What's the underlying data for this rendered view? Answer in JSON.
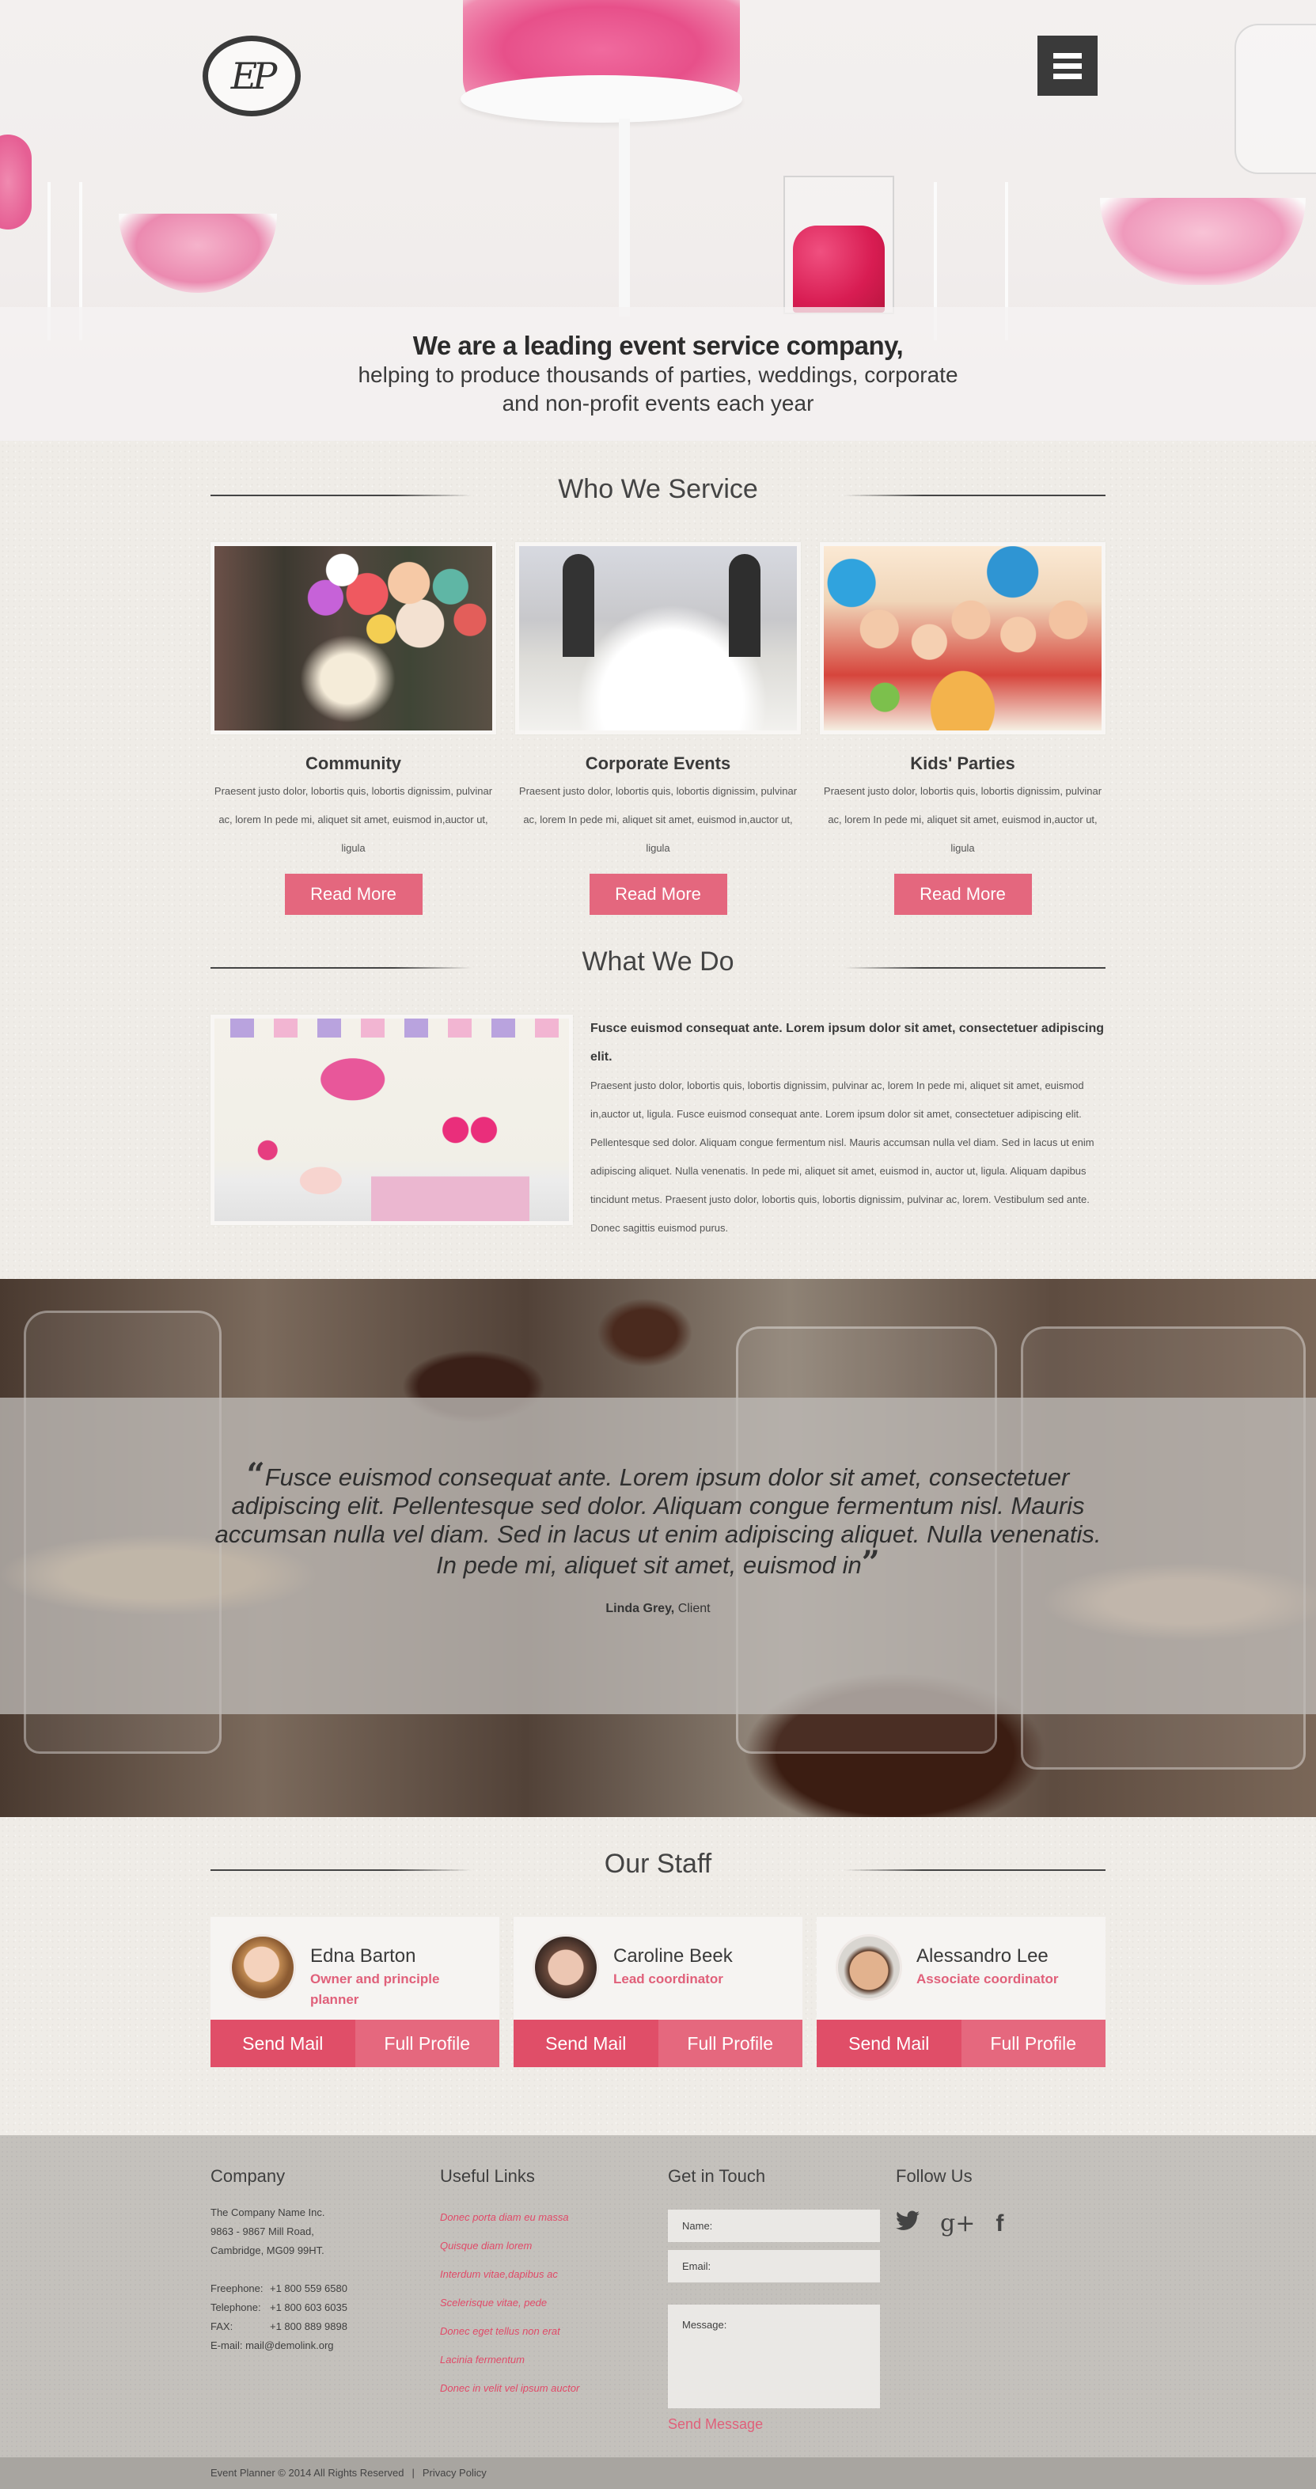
{
  "header": {
    "logo_text": "EP",
    "menu_icon": "hamburger-icon"
  },
  "hero": {
    "headline": "We are a leading event service company,",
    "subline_1": "helping to produce thousands of parties, weddings, corporate",
    "subline_2": "and non-profit events each year"
  },
  "who_we_service": {
    "title": "Who We Service",
    "items": [
      {
        "title": "Community",
        "text": "Praesent justo dolor, lobortis quis, lobortis dignissim, pulvinar ac, lorem In pede mi, aliquet sit amet, euismod in,auctor ut, ligula",
        "button": "Read More"
      },
      {
        "title": "Corporate Events",
        "text": "Praesent justo dolor, lobortis quis, lobortis dignissim, pulvinar ac, lorem In pede mi, aliquet sit amet, euismod in,auctor ut, ligula",
        "button": "Read More"
      },
      {
        "title": "Kids' Parties",
        "text": "Praesent justo dolor, lobortis quis, lobortis dignissim, pulvinar ac, lorem In pede mi, aliquet sit amet, euismod in,auctor ut, ligula",
        "button": "Read More"
      }
    ]
  },
  "what_we_do": {
    "title": "What We Do",
    "heading": "Fusce euismod consequat ante. Lorem ipsum dolor sit amet, consectetuer adipiscing elit.",
    "body": "Praesent justo dolor, lobortis quis, lobortis dignissim, pulvinar ac, lorem In pede mi, aliquet sit amet, euismod in,auctor ut, ligula. Fusce euismod consequat ante. Lorem ipsum dolor sit amet, consectetuer adipiscing elit. Pellentesque sed dolor. Aliquam congue fermentum nisl. Mauris accumsan nulla vel diam. Sed in lacus ut enim adipiscing aliquet. Nulla venenatis. In pede mi, aliquet sit amet, euismod in, auctor ut, ligula. Aliquam dapibus tincidunt metus. Praesent justo dolor, lobortis quis, lobortis dignissim, pulvinar ac, lorem. Vestibulum sed ante. Donec sagittis euismod purus."
  },
  "testimonial": {
    "open_quote": "“",
    "close_quote": "”",
    "quote": "Fusce euismod consequat ante. Lorem ipsum dolor sit amet, consectetuer adipiscing elit. Pellentesque sed dolor. Aliquam congue fermentum nisl. Mauris accumsan nulla vel diam. Sed in lacus ut enim adipiscing aliquet. Nulla venenatis. In pede mi, aliquet sit amet, euismod in",
    "author": "Linda Grey,",
    "author_role": "Client"
  },
  "staff": {
    "title": "Our Staff",
    "members": [
      {
        "name": "Edna Barton",
        "role": "Owner and principle planner",
        "mail_button": "Send Mail",
        "profile_button": "Full Profile"
      },
      {
        "name": "Caroline Beek",
        "role": "Lead coordinator",
        "mail_button": "Send Mail",
        "profile_button": "Full Profile"
      },
      {
        "name": "Alessandro Lee",
        "role": "Associate coordinator",
        "mail_button": "Send Mail",
        "profile_button": "Full Profile"
      }
    ]
  },
  "footer": {
    "company": {
      "title": "Company",
      "name": "The Company Name Inc.",
      "address_1": "9863 - 9867 Mill Road,",
      "address_2": "Cambridge, MG09 99HT.",
      "contacts": [
        {
          "label": "Freephone:",
          "value": "+1 800 559 6580"
        },
        {
          "label": "Telephone:",
          "value": "+1 800 603 6035"
        },
        {
          "label": "FAX:",
          "value": "+1 800 889 9898"
        },
        {
          "label": "E-mail:",
          "value": "mail@demolink.org"
        }
      ]
    },
    "links": {
      "title": "Useful Links",
      "items": [
        "Donec porta diam eu massa",
        "Quisque diam lorem",
        "Interdum vitae,dapibus ac",
        "Scelerisque vitae, pede",
        "Donec eget tellus non erat",
        "Lacinia fermentum",
        "Donec in velit vel ipsum auctor"
      ]
    },
    "contact_form": {
      "title": "Get in Touch",
      "name_placeholder": "Name:",
      "email_placeholder": "Email:",
      "message_placeholder": "Message:",
      "send_label": "Send Message"
    },
    "follow": {
      "title": "Follow Us",
      "icons": [
        "twitter-icon",
        "google-plus-icon",
        "facebook-icon"
      ],
      "twitter_glyph": "🐦",
      "gplus_glyph": "g+",
      "facebook_glyph": "f"
    },
    "copyright": {
      "text": "Event Planner  © 2014 All Rights Reserved",
      "separator": "|",
      "privacy": "Privacy Policy"
    }
  },
  "colors": {
    "accent_pink": "#e4677e",
    "accent_pink_dark": "#e04e68",
    "text_dark": "#3f3f3f",
    "menu_button": "#3a3a3a",
    "footer_bg": "#c4c1bc"
  }
}
